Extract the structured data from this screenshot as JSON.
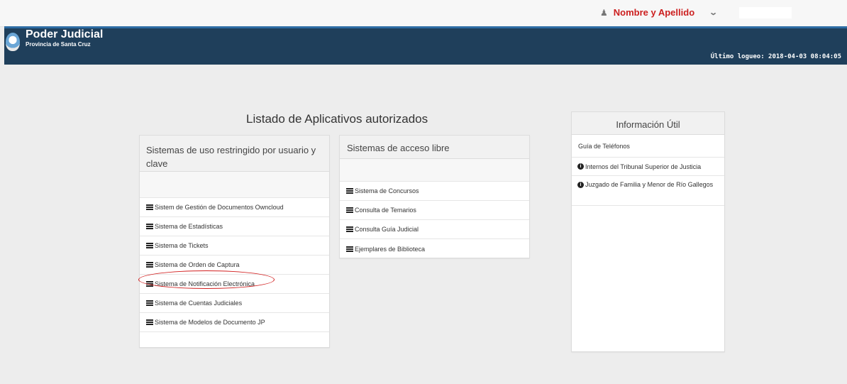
{
  "header": {
    "user_name": "Nombre y Apellido",
    "user_icon": "user-icon",
    "chevron_icon": "chevron-down-icon"
  },
  "banner": {
    "title": "Poder Judicial",
    "subtitle": "Provincia de Santa Cruz",
    "last_login": "Último logueo: 2018-04-03 08:04:05"
  },
  "main": {
    "title": "Listado de Aplicativos autorizados"
  },
  "restricted": {
    "heading": "Sistemas de uso restringido por usuario y clave",
    "items": [
      "Sistem de Gestión de Documentos Owncloud",
      "Sistema de Estadísticas",
      "Sistema de Tickets",
      "Sistema de Orden de Captura",
      "Sistema de Notificación Electrónica",
      "Sistema de Cuentas Judiciales",
      "Sistema de Modelos de Documento JP"
    ]
  },
  "free": {
    "heading": "Sistemas de acceso libre",
    "items": [
      "Sistema de Concursos",
      "Consulta de Temarios",
      "Consulta Guía Judicial",
      "Ejemplares de Biblioteca"
    ]
  },
  "info": {
    "heading": "Información Útil",
    "items": [
      "Guía de Teléfonos",
      "Internos del Tribunal Superior de Justicia",
      "Juzgado de Familia y Menor de Río Gallegos"
    ]
  },
  "colors": {
    "banner": "#1f3f5b",
    "accent_red": "#cc1f1f"
  }
}
